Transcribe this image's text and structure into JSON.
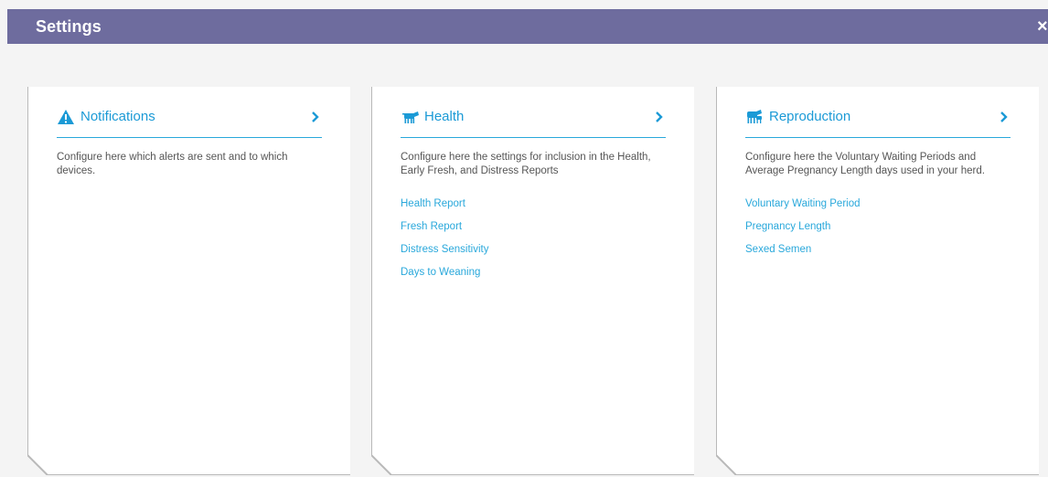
{
  "header": {
    "title": "Settings",
    "close_label": "×"
  },
  "cards": [
    {
      "title": "Notifications",
      "icon": "warning-icon",
      "description": "Configure here which alerts are sent and to which devices.",
      "links": []
    },
    {
      "title": "Health",
      "icon": "cow-icon",
      "description": "Configure here the settings for inclusion in the Health, Early Fresh, and Distress Reports",
      "links": [
        "Health Report",
        "Fresh Report",
        "Distress Sensitivity",
        "Days to Weaning"
      ]
    },
    {
      "title": "Reproduction",
      "icon": "cow-calf-icon",
      "description": "Configure here the Voluntary Waiting Periods and Average Pregnancy Length days used in your herd.",
      "links": [
        "Voluntary Waiting Period",
        "Pregnancy Length",
        "Sexed Semen"
      ]
    }
  ],
  "colors": {
    "header_bg": "#6e6c9e",
    "accent": "#29a8db",
    "page_bg": "#f4f4f4",
    "card_bg": "#ffffff"
  }
}
